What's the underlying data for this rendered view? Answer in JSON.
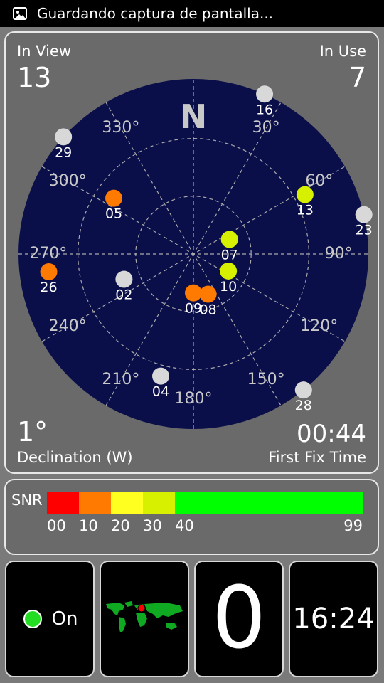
{
  "status_bar": {
    "notification_icon": "screenshot-image-icon",
    "text": "Guardando captura de pantalla..."
  },
  "sky": {
    "in_view_label": "In View",
    "in_view_value": "13",
    "in_use_label": "In Use",
    "in_use_value": "7",
    "declination_value": "1°",
    "declination_label": "Declination (W)",
    "fix_time_value": "00:44",
    "fix_time_label": "First Fix Time",
    "north_label": "N",
    "background_color": "#0a0f4a",
    "bearings": [
      {
        "label": "30°",
        "deg": 30
      },
      {
        "label": "60°",
        "deg": 60
      },
      {
        "label": "90°",
        "deg": 90
      },
      {
        "label": "120°",
        "deg": 120
      },
      {
        "label": "150°",
        "deg": 150
      },
      {
        "label": "180°",
        "deg": 180
      },
      {
        "label": "210°",
        "deg": 210
      },
      {
        "label": "240°",
        "deg": 240
      },
      {
        "label": "270°",
        "deg": 270
      },
      {
        "label": "300°",
        "deg": 300
      },
      {
        "label": "330°",
        "deg": 330
      }
    ],
    "satellites": [
      {
        "id": "16",
        "azimuth": 24,
        "elevation": 0,
        "color": "#d8d8d8"
      },
      {
        "id": "29",
        "azimuth": 312,
        "elevation": 0,
        "color": "#d8d8d8"
      },
      {
        "id": "23",
        "azimuth": 77,
        "elevation": 0,
        "color": "#d8d8d8"
      },
      {
        "id": "28",
        "azimuth": 141,
        "elevation": 0,
        "color": "#d8d8d8"
      },
      {
        "id": "04",
        "azimuth": 195,
        "elevation": 25,
        "color": "#d8d8d8"
      },
      {
        "id": "05",
        "azimuth": 305,
        "elevation": 40,
        "color": "#ff7a00"
      },
      {
        "id": "13",
        "azimuth": 62,
        "elevation": 25,
        "color": "#d6f000"
      },
      {
        "id": "07",
        "azimuth": 68,
        "elevation": 70,
        "color": "#d6f000"
      },
      {
        "id": "26",
        "azimuth": 263,
        "elevation": 15,
        "color": "#ff7a00"
      },
      {
        "id": "02",
        "azimuth": 250,
        "elevation": 52,
        "color": "#d8d8d8"
      },
      {
        "id": "10",
        "azimuth": 116,
        "elevation": 70,
        "color": "#d6f000"
      },
      {
        "id": "09",
        "azimuth": 180,
        "elevation": 70,
        "color": "#ff7a00"
      },
      {
        "id": "08",
        "azimuth": 160,
        "elevation": 68,
        "color": "#ff7a00"
      }
    ]
  },
  "snr": {
    "label": "SNR",
    "segments": [
      {
        "from": 0,
        "to": 10,
        "color": "#ff0000"
      },
      {
        "from": 10,
        "to": 20,
        "color": "#ff7a00"
      },
      {
        "from": 20,
        "to": 30,
        "color": "#ffff20"
      },
      {
        "from": 30,
        "to": 40,
        "color": "#d6f000"
      },
      {
        "from": 40,
        "to": 99,
        "color": "#00ff00"
      }
    ],
    "ticks": [
      "00",
      "10",
      "20",
      "30",
      "40",
      "99"
    ]
  },
  "bottom": {
    "gps_state_label": "On",
    "gps_state_color": "#22dd22",
    "world_map_icon": "world-map-icon",
    "world_marker_color": "#ff0000",
    "big_number": "0",
    "clock": "16:24"
  }
}
